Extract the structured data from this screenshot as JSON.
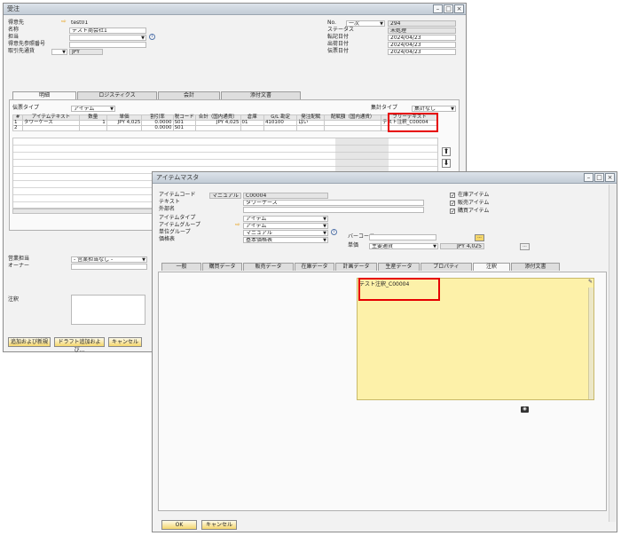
{
  "order": {
    "title": "受注",
    "header_left": [
      {
        "label": "得意先",
        "value": "test01",
        "arrow": true
      },
      {
        "label": "名称",
        "value": "テスト商会社1"
      },
      {
        "label": "担当",
        "value": ""
      },
      {
        "label": "得意先参照番号",
        "value": ""
      },
      {
        "label": "取引先通貨",
        "value": "JPY"
      }
    ],
    "header_right": [
      {
        "label": "No.",
        "prefix": "一次",
        "value": "294"
      },
      {
        "label": "ステータス",
        "value": "未処理"
      },
      {
        "label": "転記日付",
        "value": "2024/04/23"
      },
      {
        "label": "出荷日付",
        "value": "2024/04/23"
      },
      {
        "label": "伝票日付",
        "value": "2024/04/23"
      }
    ],
    "tabs": [
      "明細",
      "ロジスティクス",
      "会計",
      "添付文書"
    ],
    "doc_type_label": "伝票タイプ",
    "doc_type_value": "アイテム",
    "summary_type_label": "集計タイプ",
    "summary_type_value": "集計なし",
    "grid_headers": [
      "#",
      "アイテムテキスト",
      "数量",
      "単価",
      "割引率",
      "税コード",
      "合計（国内通貨）",
      "倉庫",
      "G/L 勘定",
      "発注配賦",
      "配賦額（国内通貨）",
      "フリーテキスト"
    ],
    "grid_rows": [
      [
        "1",
        "タワーケース",
        "1",
        "JPY 4,025",
        "0.0000",
        "S01",
        "JPY 4,025",
        "01",
        "410100",
        "はい",
        "",
        "テスト注釈_C00004"
      ],
      [
        "2",
        "",
        "",
        "",
        "0.0000",
        "S01",
        "",
        "",
        "",
        "",
        "",
        ""
      ]
    ],
    "sales_rep_label": "営業担当",
    "sales_rep_value": "- 営業担当なし -",
    "owner_label": "オーナー",
    "remarks_label": "注釈",
    "buttons": [
      "追加および新規",
      "ドラフト追加および...",
      "キャンセル"
    ]
  },
  "item": {
    "title": "アイテムマスタ",
    "item_code_label": "アイテムコード",
    "series": "マニュアル",
    "item_code": "C00004",
    "text_label": "テキスト",
    "text_value": "タワーケース",
    "foreign_name_label": "外部名",
    "item_type_label": "アイテムタイプ",
    "item_type_value": "アイテム",
    "item_group_label": "アイテムグループ",
    "item_group_value": "アイテム",
    "uom_group_label": "単位グループ",
    "uom_group_value": "マニュアル",
    "price_list_label": "価格表",
    "price_list_value": "基本価格表",
    "barcode_label": "バーコード",
    "unit_price_label": "単価",
    "price_currency": "主要通貨",
    "price_value": "JPY 4,025",
    "checkboxes": [
      {
        "label": "在庫アイテム",
        "checked": true
      },
      {
        "label": "販売アイテム",
        "checked": true
      },
      {
        "label": "購買アイテム",
        "checked": true
      }
    ],
    "tabs": [
      "一般",
      "購買データ",
      "販売データ",
      "在庫データ",
      "計画データ",
      "生産データ",
      "プロパティ",
      "注釈",
      "添付文書"
    ],
    "active_tab": "注釈",
    "remarks_text": "テスト注釈_C00004",
    "buttons": [
      "OK",
      "キャンセル"
    ]
  },
  "colors": {
    "note_bg": "#fdf1a9",
    "highlight": "#e60000",
    "button": "#f4d66b"
  }
}
